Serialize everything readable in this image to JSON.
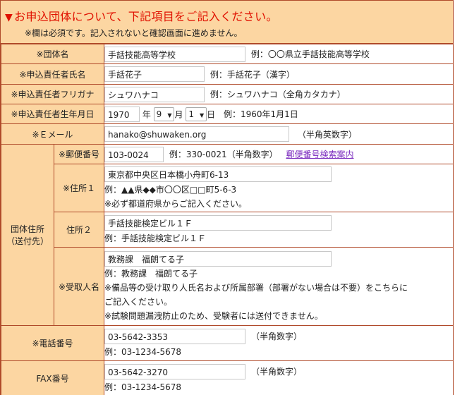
{
  "header": {
    "title_mark": "▼",
    "title": "お申込団体について、下記項目をご記入ください。",
    "note": "※欄は必須です。記入されないと確認画面に進めません。"
  },
  "rows": {
    "org_name": {
      "label": "※団体名",
      "value": "手話技能高等学校",
      "example": "例：〇〇県立手話技能高等学校"
    },
    "person_name": {
      "label": "※申込責任者氏名",
      "value": "手話花子",
      "example": "例：手話花子（漢字）"
    },
    "person_kana": {
      "label": "※申込責任者フリガナ",
      "value": "シュワハナコ",
      "example": "例：シュワハナコ（全角カタカナ）"
    },
    "birth": {
      "label": "※申込責任者生年月日",
      "year": "1970",
      "year_unit": "年",
      "month": "9",
      "month_unit": "月",
      "day": "1",
      "day_unit": "日",
      "example": "例：1960年1月1日"
    },
    "email": {
      "label": "※Ｅメール",
      "value": "hanako@shuwaken.org",
      "hint": "（半角英数字）"
    },
    "address": {
      "group_label_1": "団体住所",
      "group_label_2": "（送付先）",
      "postal": {
        "label": "※郵便番号",
        "value": "103-0024",
        "example": "例：330-0021（半角数字）",
        "link": "郵便番号検索案内"
      },
      "addr1": {
        "label": "※住所１",
        "value": "東京都中央区日本橋小舟町6-13",
        "example": "例：▲▲県◆◆市〇〇区□□町5-6-3",
        "note": "※必ず都道府県からご記入ください。"
      },
      "addr2": {
        "label": "住所２",
        "value": "手話技能検定ビル１Ｆ",
        "example": "例：手話技能検定ビル１Ｆ"
      },
      "recipient": {
        "label": "※受取人名",
        "value": "教務課　福朗てる子",
        "example": "例：教務課　福朗てる子",
        "note1": "※備品等の受け取り人氏名および所属部署（部署がない場合は不要）をこちらに",
        "note2": "ご記入ください。",
        "note3": "※試験問題漏洩防止のため、受験者には送付できません。"
      }
    },
    "phone": {
      "label": "※電話番号",
      "value": "03-5642-3353",
      "hint": "（半角数字）",
      "example": "例：03-1234-5678"
    },
    "fax": {
      "label": "FAX番号",
      "value": "03-5642-3270",
      "hint": "（半角数字）",
      "example": "例：03-1234-5678"
    }
  },
  "colors": {
    "border": "#b04a2a",
    "label_bg": "#fcd6a2",
    "title": "#e01000",
    "link": "#7b2bbf"
  }
}
